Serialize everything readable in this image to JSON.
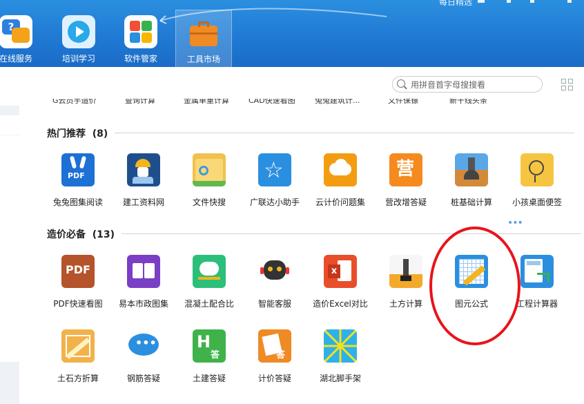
{
  "topbar": {
    "title_fragment": "每日精选",
    "nav": [
      {
        "label": "在线服务",
        "icon": "online-service-icon"
      },
      {
        "label": "培训学习",
        "icon": "training-video-icon"
      },
      {
        "label": "软件管家",
        "icon": "software-manager-icon"
      },
      {
        "label": "工具市场",
        "icon": "toolbox-icon",
        "active": true
      }
    ]
  },
  "search": {
    "placeholder": "用拼音首字母搜搜看"
  },
  "cut_row": [
    "G云员手造价",
    "查询计算",
    "金属单重计算",
    "CAD快速看图",
    "兔兔建筑计...",
    "文件保镖",
    "新干线头条"
  ],
  "sections": [
    {
      "title": "热门推荐",
      "count": "(8)"
    },
    {
      "title": "造价必备",
      "count": "(13)"
    }
  ],
  "hot": [
    {
      "label": "兔兔图集阅读",
      "icon": "pdf-rabbit-icon"
    },
    {
      "label": "建工资料网",
      "icon": "construction-worker-icon"
    },
    {
      "label": "文件快搜",
      "icon": "folder-search-icon"
    },
    {
      "label": "广联达小助手",
      "icon": "assistant-star-icon"
    },
    {
      "label": "云计价问题集",
      "icon": "cloud-pricing-icon"
    },
    {
      "label": "营改增答疑",
      "icon": "ying-badge-icon"
    },
    {
      "label": "桩基础计算",
      "icon": "pile-foundation-icon"
    },
    {
      "label": "小孩桌面便签",
      "icon": "desk-note-icon"
    }
  ],
  "cost": [
    {
      "label": "PDF快速看图",
      "icon": "pdf-viewer-icon"
    },
    {
      "label": "易本市政图集",
      "icon": "book-icon"
    },
    {
      "label": "混凝土配合比",
      "icon": "concrete-mixer-icon"
    },
    {
      "label": "智能客服",
      "icon": "robot-service-icon"
    },
    {
      "label": "造价Excel对比",
      "icon": "excel-compare-icon"
    },
    {
      "label": "土方计算",
      "icon": "earthwork-icon"
    },
    {
      "label": "图元公式",
      "icon": "ruler-grid-icon"
    },
    {
      "label": "工程计算器",
      "icon": "calculator-icon"
    },
    {
      "label": "土石方折算",
      "icon": "ruler-folder-icon"
    },
    {
      "label": "钢筋答疑",
      "icon": "chat-bubble-icon"
    },
    {
      "label": "土建答疑",
      "icon": "tujian-answer-icon"
    },
    {
      "label": "计价答疑",
      "icon": "pricing-answer-icon"
    },
    {
      "label": "湖北脚手架",
      "icon": "scaffold-icon"
    }
  ],
  "colors": {
    "topbar": "#1f78d2",
    "annotation": "#e8141b"
  }
}
